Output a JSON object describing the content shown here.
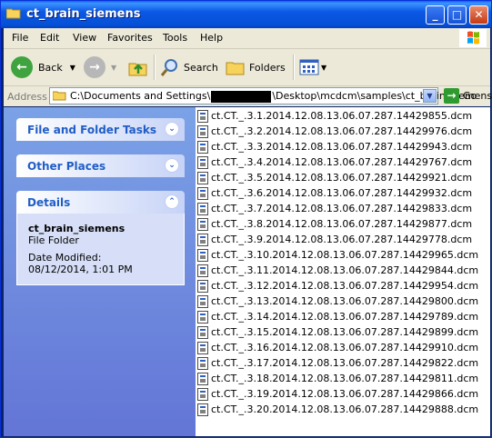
{
  "window": {
    "title": "ct_brain_siemens"
  },
  "menu": [
    "File",
    "Edit",
    "View",
    "Favorites",
    "Tools",
    "Help"
  ],
  "toolbar": {
    "back": "Back",
    "search": "Search",
    "folders": "Folders"
  },
  "address": {
    "label": "Address",
    "path_prefix": "C:\\Documents and Settings\\",
    "path_suffix": "\\Desktop\\mcdcm\\samples\\ct_brain_siemens",
    "go": "Go"
  },
  "tasks": {
    "file_folder": "File and Folder Tasks",
    "other_places": "Other Places",
    "details": {
      "header": "Details",
      "name": "ct_brain_siemens",
      "type": "File Folder",
      "modified": "Date Modified: 08/12/2014, 1:01 PM"
    }
  },
  "files": [
    "ct.CT._.3.1.2014.12.08.13.06.07.287.14429855.dcm",
    "ct.CT._.3.2.2014.12.08.13.06.07.287.14429976.dcm",
    "ct.CT._.3.3.2014.12.08.13.06.07.287.14429943.dcm",
    "ct.CT._.3.4.2014.12.08.13.06.07.287.14429767.dcm",
    "ct.CT._.3.5.2014.12.08.13.06.07.287.14429921.dcm",
    "ct.CT._.3.6.2014.12.08.13.06.07.287.14429932.dcm",
    "ct.CT._.3.7.2014.12.08.13.06.07.287.14429833.dcm",
    "ct.CT._.3.8.2014.12.08.13.06.07.287.14429877.dcm",
    "ct.CT._.3.9.2014.12.08.13.06.07.287.14429778.dcm",
    "ct.CT._.3.10.2014.12.08.13.06.07.287.14429965.dcm",
    "ct.CT._.3.11.2014.12.08.13.06.07.287.14429844.dcm",
    "ct.CT._.3.12.2014.12.08.13.06.07.287.14429954.dcm",
    "ct.CT._.3.13.2014.12.08.13.06.07.287.14429800.dcm",
    "ct.CT._.3.14.2014.12.08.13.06.07.287.14429789.dcm",
    "ct.CT._.3.15.2014.12.08.13.06.07.287.14429899.dcm",
    "ct.CT._.3.16.2014.12.08.13.06.07.287.14429910.dcm",
    "ct.CT._.3.17.2014.12.08.13.06.07.287.14429822.dcm",
    "ct.CT._.3.18.2014.12.08.13.06.07.287.14429811.dcm",
    "ct.CT._.3.19.2014.12.08.13.06.07.287.14429866.dcm",
    "ct.CT._.3.20.2014.12.08.13.06.07.287.14429888.dcm"
  ]
}
